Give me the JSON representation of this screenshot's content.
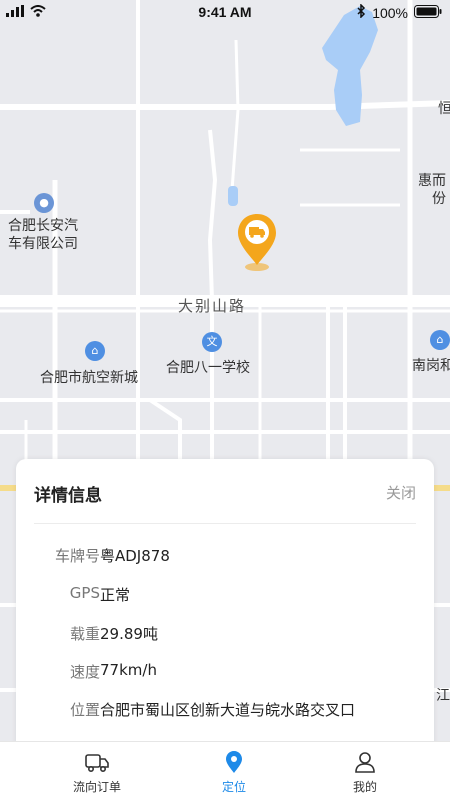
{
  "status_bar": {
    "time": "9:41 AM",
    "battery": "100%"
  },
  "map": {
    "road_label": "大别山路",
    "pois": [
      {
        "name_line1": "合肥长安汽",
        "name_line2": "车有限公司"
      },
      {
        "name": "合肥市航空新城",
        "icon": "⌂"
      },
      {
        "name": "合肥八一学校",
        "icon": "文"
      },
      {
        "name": "南岗和"
      }
    ],
    "edge_labels": [
      "恒",
      "惠而",
      "份",
      "江陵"
    ]
  },
  "details": {
    "title": "详情信息",
    "close": "关闭",
    "rows": [
      {
        "label": "车牌号",
        "value": "粤ADJ878"
      },
      {
        "label": "GPS",
        "value": "正常"
      },
      {
        "label": "载重",
        "value": "29.89吨"
      },
      {
        "label": "速度",
        "value": "77km/h"
      },
      {
        "label": "位置",
        "value": "合肥市蜀山区创新大道与皖水路交叉口"
      }
    ]
  },
  "nav": {
    "items": [
      {
        "label": "流向订单"
      },
      {
        "label": "定位"
      },
      {
        "label": "我的"
      }
    ],
    "active_color": "#1e8ae8"
  },
  "colors": {
    "marker": "#f4a61c",
    "water": "#a9cdf7",
    "poi": "#4f8fe2"
  }
}
